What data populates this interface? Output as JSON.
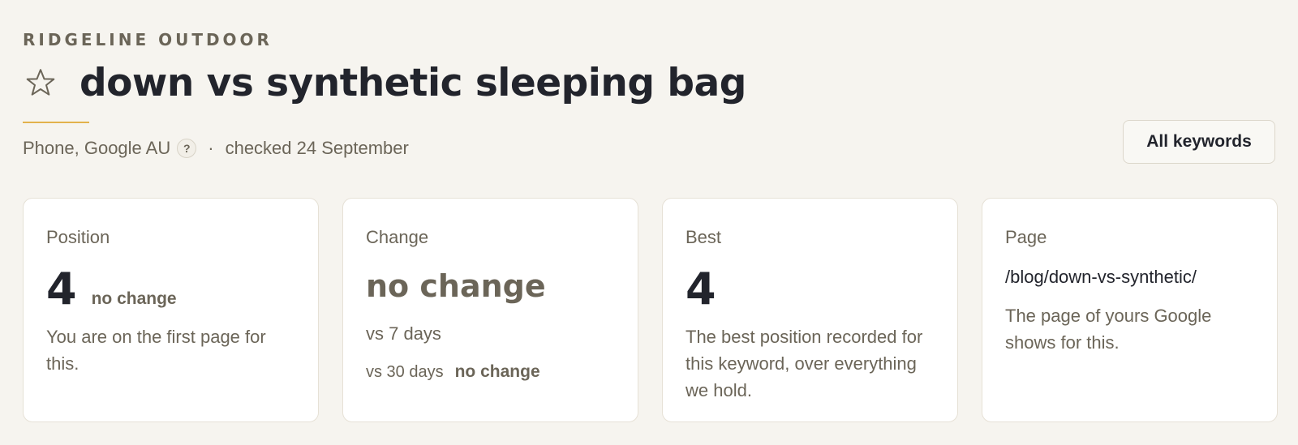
{
  "header": {
    "brand": "RIDGELINE OUTDOOR",
    "title": "down vs synthetic sleeping bag",
    "star_icon": "star-outline-icon",
    "meta": {
      "device_engine": "Phone, Google AU",
      "help_label": "?",
      "separator": "·",
      "checked": "checked 24 September"
    },
    "all_keywords_label": "All keywords"
  },
  "cards": {
    "position": {
      "label": "Position",
      "value": "4",
      "change": "no change",
      "description": "You are on the first page for this."
    },
    "change": {
      "label": "Change",
      "value": "no change",
      "vs7": "vs 7 days",
      "vs30_label": "vs 30 days",
      "vs30_value": "no change"
    },
    "best": {
      "label": "Best",
      "value": "4",
      "description": "The best position recorded for this keyword, over everything we hold."
    },
    "page": {
      "label": "Page",
      "path": "/blog/down-vs-synthetic/",
      "description": "The page of yours Google shows for this."
    }
  },
  "colors": {
    "background": "#f6f4ef",
    "accent_rule": "#e2b24c",
    "text_dark": "#22242c",
    "text_muted": "#6b6558"
  }
}
